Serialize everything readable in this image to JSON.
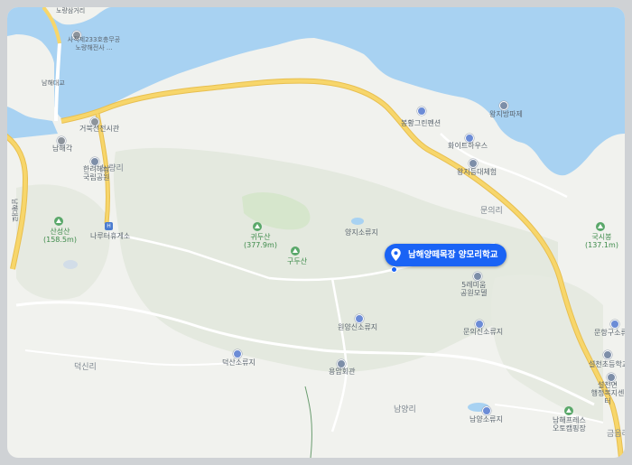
{
  "map": {
    "colors": {
      "water": "#a8d2f2",
      "land": "#f1f2ee",
      "forest": "#e4e9df",
      "road": "#f7d66b",
      "road_edge": "#e8bf4f",
      "marker": "#1a63f5"
    },
    "marker": {
      "label": "남해양떼목장 양모리학교",
      "icon": "location-pin-icon"
    },
    "labels": {
      "top_road": "노량삼거리",
      "memorial": "사적제233호충무공\n노량해전사 ...",
      "namhae_bridge": "남해대교",
      "exhibit": "거북선전시관",
      "namhae_kak": "남해각",
      "noryang": "노량리",
      "hallyeo_park": "한려해상\n국립공원",
      "rest_area": "나루터휴게소",
      "sanseongsan": "산성산\n(158.5m)",
      "gwidusan": "귀두산\n(377.9m)",
      "gudusan": "구두산",
      "yangji_reservoir": "양지소류지",
      "munui": "문의리",
      "guksibong": "국시봉\n(137.1m)",
      "bonghwang": "봉황그린펜션",
      "white_house": "화이트하우스",
      "wangji_sign": "왕지등대체험",
      "wangji_pan": "왕지방파제",
      "garden": "5레미움\n공원모델",
      "munui_reservoir": "문의신소류지",
      "wonyang_reservoir": "원양신소류지",
      "hall": "용암회관",
      "deoksan_reservoir": "덕산소류지",
      "deoksin": "덕신리",
      "namyang": "남양리",
      "namyang_reservoir": "남양소류지",
      "camping": "남해프레스\n오토캠핑장",
      "seolcheon_school": "설천초등학교",
      "welfare": "설천면\n행정복지센터",
      "geumeum": "금음리",
      "mungu_reservoir": "문항구소류지",
      "road_side": "남해대로"
    }
  }
}
